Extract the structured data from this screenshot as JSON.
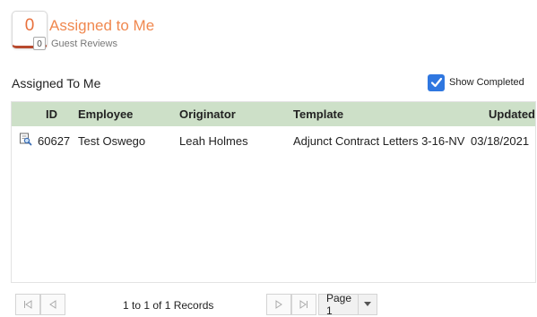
{
  "header": {
    "count": "0",
    "title": "Assigned to Me",
    "sub_badge": "0",
    "sub_label": "Guest Reviews"
  },
  "section": {
    "title": "Assigned To Me",
    "show_completed_label": "Show Completed",
    "show_completed_checked": true
  },
  "grid": {
    "columns": [
      "ID",
      "Employee",
      "Originator",
      "Template",
      "Updated"
    ],
    "rows": [
      {
        "icon": "document-view-icon",
        "id": "60627",
        "employee": "Test Oswego",
        "originator": "Leah Holmes",
        "template": "Adjunct Contract Letters 3-16-NV",
        "updated": "03/18/2021"
      }
    ]
  },
  "pager": {
    "records_text": "1 to 1 of 1 Records",
    "page_text": "Page 1"
  },
  "colors": {
    "accent": "#e8703c",
    "header_bg": "#cde0c8",
    "checkbox": "#2f77e0"
  }
}
